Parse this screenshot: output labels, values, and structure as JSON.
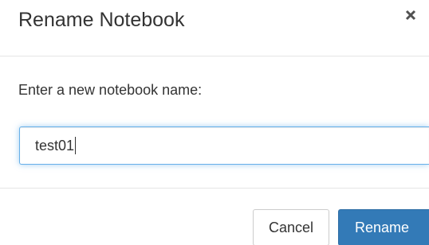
{
  "dialog": {
    "title": "Rename Notebook",
    "close_icon": "close-icon"
  },
  "body": {
    "prompt": "Enter a new notebook name:",
    "input_value": "test01"
  },
  "footer": {
    "cancel_label": "Cancel",
    "rename_label": "Rename"
  },
  "colors": {
    "primary": "#337ab7",
    "focus_border": "#66afe9",
    "divider": "#e5e5e5"
  }
}
